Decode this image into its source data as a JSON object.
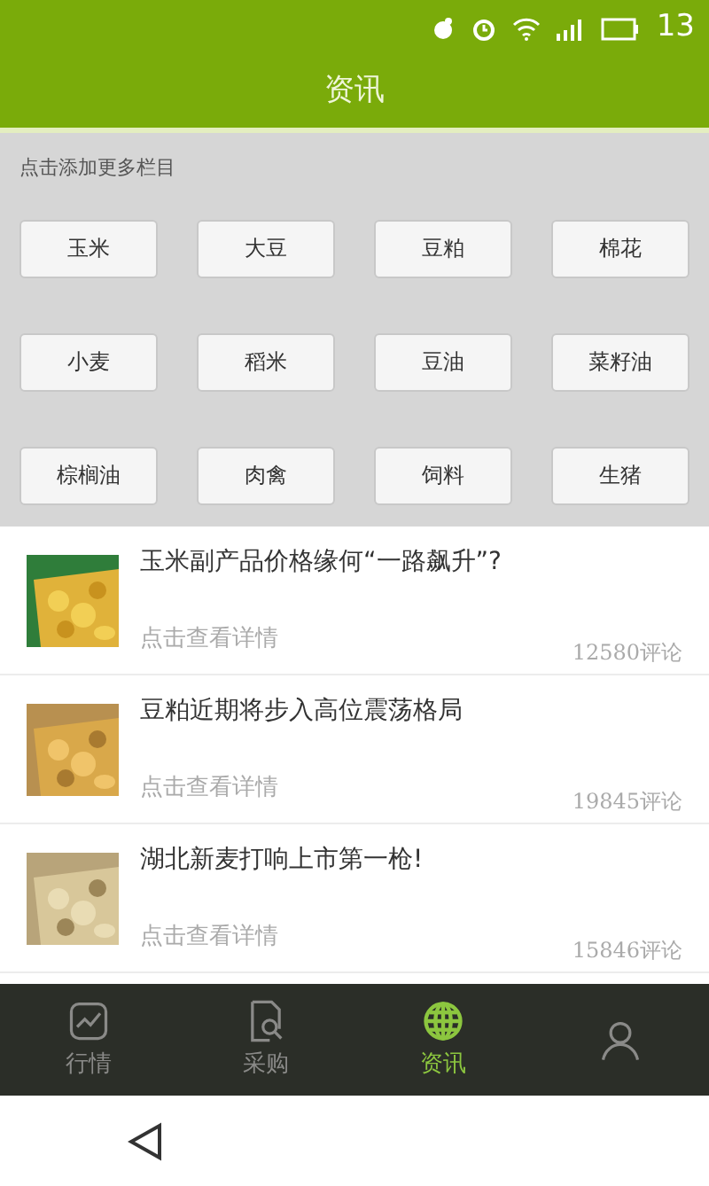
{
  "status_bar": {
    "time": "13"
  },
  "header": {
    "title": "资讯"
  },
  "channels": {
    "hint": "点击添加更多栏目",
    "items": [
      "玉米",
      "大豆",
      "豆粕",
      "棉花",
      "小麦",
      "稻米",
      "豆油",
      "菜籽油",
      "棕榈油",
      "肉禽",
      "饲料",
      "生猪"
    ]
  },
  "news": [
    {
      "title": "玉米副产品价格缘何“一路飙升”?",
      "subtitle": "点击查看详情",
      "comments": "12580评论",
      "kind": "corn"
    },
    {
      "title": "豆粕近期将步入高位震荡格局",
      "subtitle": "点击查看详情",
      "comments": "19845评论",
      "kind": "beans"
    },
    {
      "title": "湖北新麦打响上市第一枪!",
      "subtitle": "点击查看详情",
      "comments": "15846评论",
      "kind": "wheat"
    }
  ],
  "tab_bar": [
    {
      "label": "行情",
      "kind": "chart",
      "selected": false
    },
    {
      "label": "采购",
      "kind": "doc",
      "selected": false
    },
    {
      "label": "资讯",
      "kind": "globe",
      "selected": true
    },
    {
      "kind": "user",
      "selected": false
    }
  ]
}
